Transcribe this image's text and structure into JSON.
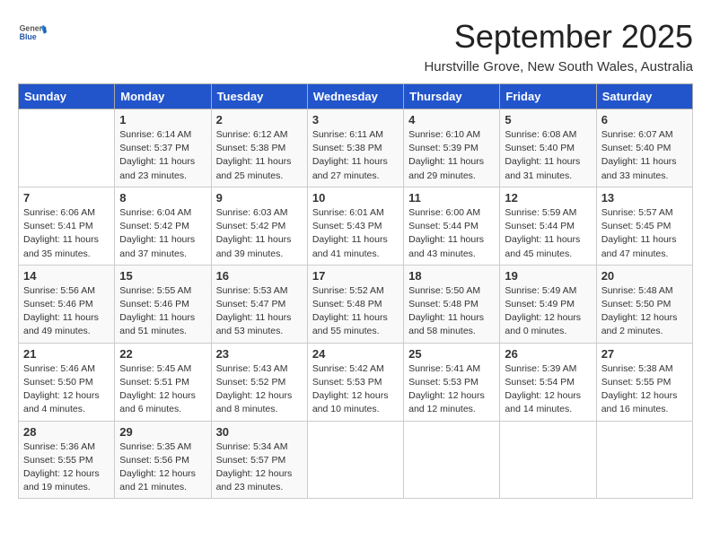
{
  "header": {
    "logo_general": "General",
    "logo_blue": "Blue",
    "month_title": "September 2025",
    "location": "Hurstville Grove, New South Wales, Australia"
  },
  "days_of_week": [
    "Sunday",
    "Monday",
    "Tuesday",
    "Wednesday",
    "Thursday",
    "Friday",
    "Saturday"
  ],
  "weeks": [
    [
      {
        "day": "",
        "info": ""
      },
      {
        "day": "1",
        "info": "Sunrise: 6:14 AM\nSunset: 5:37 PM\nDaylight: 11 hours\nand 23 minutes."
      },
      {
        "day": "2",
        "info": "Sunrise: 6:12 AM\nSunset: 5:38 PM\nDaylight: 11 hours\nand 25 minutes."
      },
      {
        "day": "3",
        "info": "Sunrise: 6:11 AM\nSunset: 5:38 PM\nDaylight: 11 hours\nand 27 minutes."
      },
      {
        "day": "4",
        "info": "Sunrise: 6:10 AM\nSunset: 5:39 PM\nDaylight: 11 hours\nand 29 minutes."
      },
      {
        "day": "5",
        "info": "Sunrise: 6:08 AM\nSunset: 5:40 PM\nDaylight: 11 hours\nand 31 minutes."
      },
      {
        "day": "6",
        "info": "Sunrise: 6:07 AM\nSunset: 5:40 PM\nDaylight: 11 hours\nand 33 minutes."
      }
    ],
    [
      {
        "day": "7",
        "info": "Sunrise: 6:06 AM\nSunset: 5:41 PM\nDaylight: 11 hours\nand 35 minutes."
      },
      {
        "day": "8",
        "info": "Sunrise: 6:04 AM\nSunset: 5:42 PM\nDaylight: 11 hours\nand 37 minutes."
      },
      {
        "day": "9",
        "info": "Sunrise: 6:03 AM\nSunset: 5:42 PM\nDaylight: 11 hours\nand 39 minutes."
      },
      {
        "day": "10",
        "info": "Sunrise: 6:01 AM\nSunset: 5:43 PM\nDaylight: 11 hours\nand 41 minutes."
      },
      {
        "day": "11",
        "info": "Sunrise: 6:00 AM\nSunset: 5:44 PM\nDaylight: 11 hours\nand 43 minutes."
      },
      {
        "day": "12",
        "info": "Sunrise: 5:59 AM\nSunset: 5:44 PM\nDaylight: 11 hours\nand 45 minutes."
      },
      {
        "day": "13",
        "info": "Sunrise: 5:57 AM\nSunset: 5:45 PM\nDaylight: 11 hours\nand 47 minutes."
      }
    ],
    [
      {
        "day": "14",
        "info": "Sunrise: 5:56 AM\nSunset: 5:46 PM\nDaylight: 11 hours\nand 49 minutes."
      },
      {
        "day": "15",
        "info": "Sunrise: 5:55 AM\nSunset: 5:46 PM\nDaylight: 11 hours\nand 51 minutes."
      },
      {
        "day": "16",
        "info": "Sunrise: 5:53 AM\nSunset: 5:47 PM\nDaylight: 11 hours\nand 53 minutes."
      },
      {
        "day": "17",
        "info": "Sunrise: 5:52 AM\nSunset: 5:48 PM\nDaylight: 11 hours\nand 55 minutes."
      },
      {
        "day": "18",
        "info": "Sunrise: 5:50 AM\nSunset: 5:48 PM\nDaylight: 11 hours\nand 58 minutes."
      },
      {
        "day": "19",
        "info": "Sunrise: 5:49 AM\nSunset: 5:49 PM\nDaylight: 12 hours\nand 0 minutes."
      },
      {
        "day": "20",
        "info": "Sunrise: 5:48 AM\nSunset: 5:50 PM\nDaylight: 12 hours\nand 2 minutes."
      }
    ],
    [
      {
        "day": "21",
        "info": "Sunrise: 5:46 AM\nSunset: 5:50 PM\nDaylight: 12 hours\nand 4 minutes."
      },
      {
        "day": "22",
        "info": "Sunrise: 5:45 AM\nSunset: 5:51 PM\nDaylight: 12 hours\nand 6 minutes."
      },
      {
        "day": "23",
        "info": "Sunrise: 5:43 AM\nSunset: 5:52 PM\nDaylight: 12 hours\nand 8 minutes."
      },
      {
        "day": "24",
        "info": "Sunrise: 5:42 AM\nSunset: 5:53 PM\nDaylight: 12 hours\nand 10 minutes."
      },
      {
        "day": "25",
        "info": "Sunrise: 5:41 AM\nSunset: 5:53 PM\nDaylight: 12 hours\nand 12 minutes."
      },
      {
        "day": "26",
        "info": "Sunrise: 5:39 AM\nSunset: 5:54 PM\nDaylight: 12 hours\nand 14 minutes."
      },
      {
        "day": "27",
        "info": "Sunrise: 5:38 AM\nSunset: 5:55 PM\nDaylight: 12 hours\nand 16 minutes."
      }
    ],
    [
      {
        "day": "28",
        "info": "Sunrise: 5:36 AM\nSunset: 5:55 PM\nDaylight: 12 hours\nand 19 minutes."
      },
      {
        "day": "29",
        "info": "Sunrise: 5:35 AM\nSunset: 5:56 PM\nDaylight: 12 hours\nand 21 minutes."
      },
      {
        "day": "30",
        "info": "Sunrise: 5:34 AM\nSunset: 5:57 PM\nDaylight: 12 hours\nand 23 minutes."
      },
      {
        "day": "",
        "info": ""
      },
      {
        "day": "",
        "info": ""
      },
      {
        "day": "",
        "info": ""
      },
      {
        "day": "",
        "info": ""
      }
    ]
  ]
}
